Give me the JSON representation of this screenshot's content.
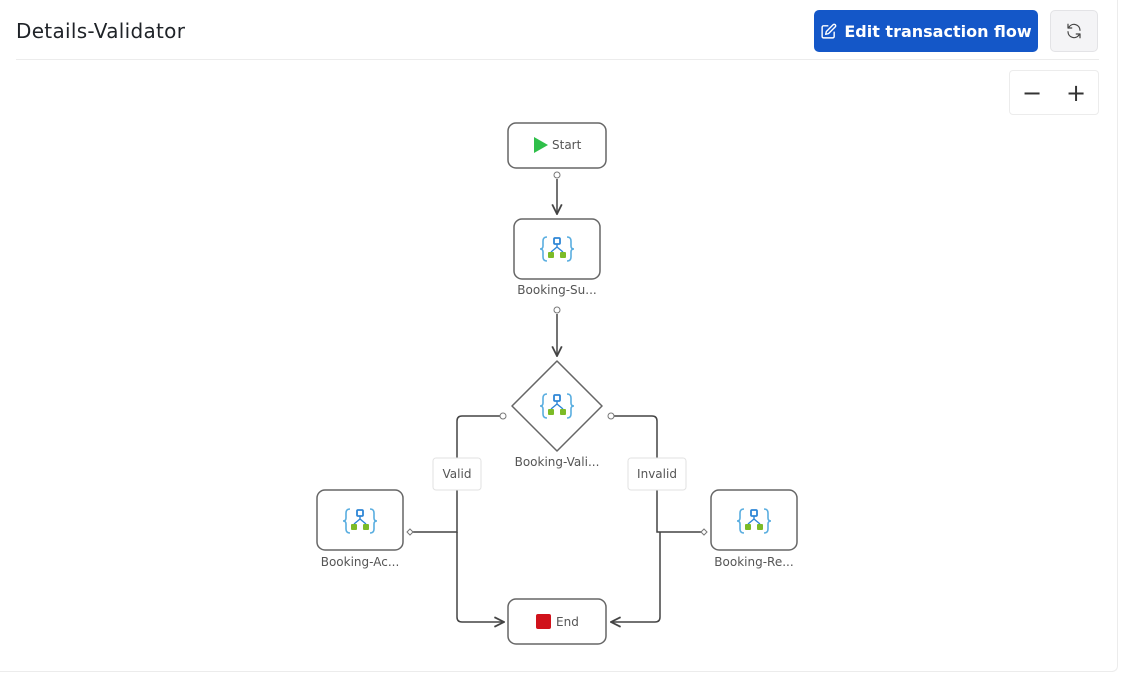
{
  "header": {
    "title": "Details-Validator",
    "edit_button_label": "Edit transaction flow",
    "edit_icon": "pencil-square-icon",
    "refresh_icon": "refresh-icon"
  },
  "zoom_controls": {
    "zoom_out": "−",
    "zoom_in": "+"
  },
  "colors": {
    "primary": "#1457c8",
    "start": "#2fbf4a",
    "end": "#d0121b",
    "icon_blue": "#2e86d6",
    "icon_green": "#7cbb27"
  },
  "flow": {
    "nodes": [
      {
        "id": "start",
        "type": "start",
        "label": "Start"
      },
      {
        "id": "booking-su",
        "type": "process",
        "label": "Booking-Su..."
      },
      {
        "id": "booking-vali",
        "type": "decision",
        "label": "Booking-Vali..."
      },
      {
        "id": "booking-ac",
        "type": "process",
        "label": "Booking-Ac..."
      },
      {
        "id": "booking-re",
        "type": "process",
        "label": "Booking-Re..."
      },
      {
        "id": "end",
        "type": "end",
        "label": "End"
      }
    ],
    "edges": [
      {
        "from": "start",
        "to": "booking-su",
        "label": ""
      },
      {
        "from": "booking-su",
        "to": "booking-vali",
        "label": ""
      },
      {
        "from": "booking-vali",
        "to": "booking-ac",
        "label": "Valid"
      },
      {
        "from": "booking-vali",
        "to": "booking-re",
        "label": "Invalid"
      },
      {
        "from": "booking-ac",
        "to": "end",
        "label": ""
      },
      {
        "from": "booking-re",
        "to": "end",
        "label": ""
      }
    ]
  }
}
